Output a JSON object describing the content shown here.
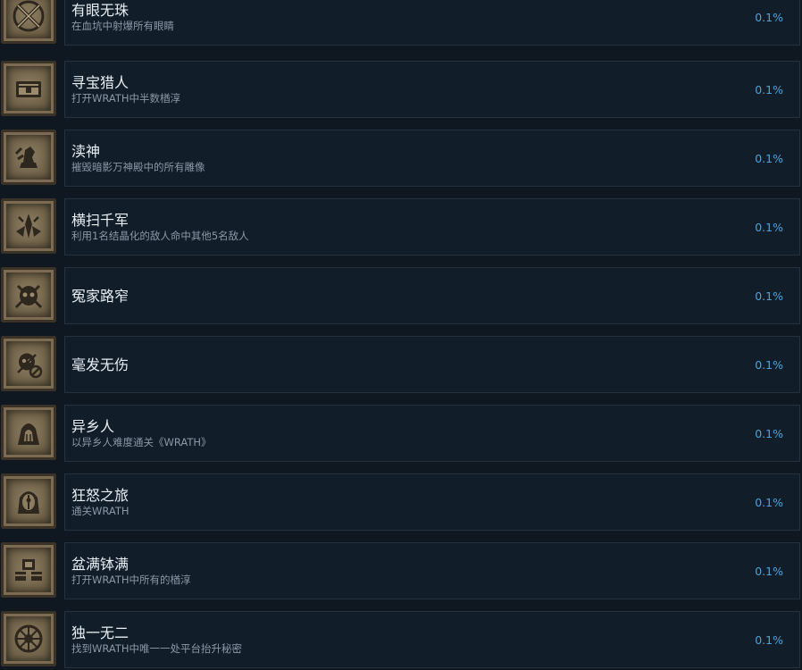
{
  "achievements": [
    {
      "title": "有眼无珠",
      "desc": "在血坑中射爆所有眼睛",
      "percent": "0.1%",
      "icon": "crossed-blades-icon"
    },
    {
      "title": "寻宝猎人",
      "desc": "打开WRATH中半数楢淳",
      "percent": "0.1%",
      "icon": "treasure-chest-icon"
    },
    {
      "title": "渎神",
      "desc": "摧毁暗影万神殿中的所有雕像",
      "percent": "0.1%",
      "icon": "broken-statue-icon"
    },
    {
      "title": "横扫千军",
      "desc": "利用1名结晶化的敌人命中其他5名敌人",
      "percent": "0.1%",
      "icon": "crystal-burst-icon"
    },
    {
      "title": "冤家路窄",
      "desc": "",
      "percent": "0.1%",
      "icon": "demon-skull-icon"
    },
    {
      "title": "毫发无伤",
      "desc": "",
      "percent": "0.1%",
      "icon": "skull-no-damage-icon"
    },
    {
      "title": "异乡人",
      "desc": "以异乡人难度通关《WRATH》",
      "percent": "0.1%",
      "icon": "hooded-outlander-icon"
    },
    {
      "title": "狂怒之旅",
      "desc": "通关WRATH",
      "percent": "0.1%",
      "icon": "hooded-helmet-icon"
    },
    {
      "title": "盆满钵满",
      "desc": "打开WRATH中所有的楢淳",
      "percent": "0.1%",
      "icon": "treasure-stack-icon"
    },
    {
      "title": "独一无二",
      "desc": "找到WRATH中唯一一处平台抬升秘密",
      "percent": "0.1%",
      "icon": "rune-wheel-icon"
    }
  ]
}
